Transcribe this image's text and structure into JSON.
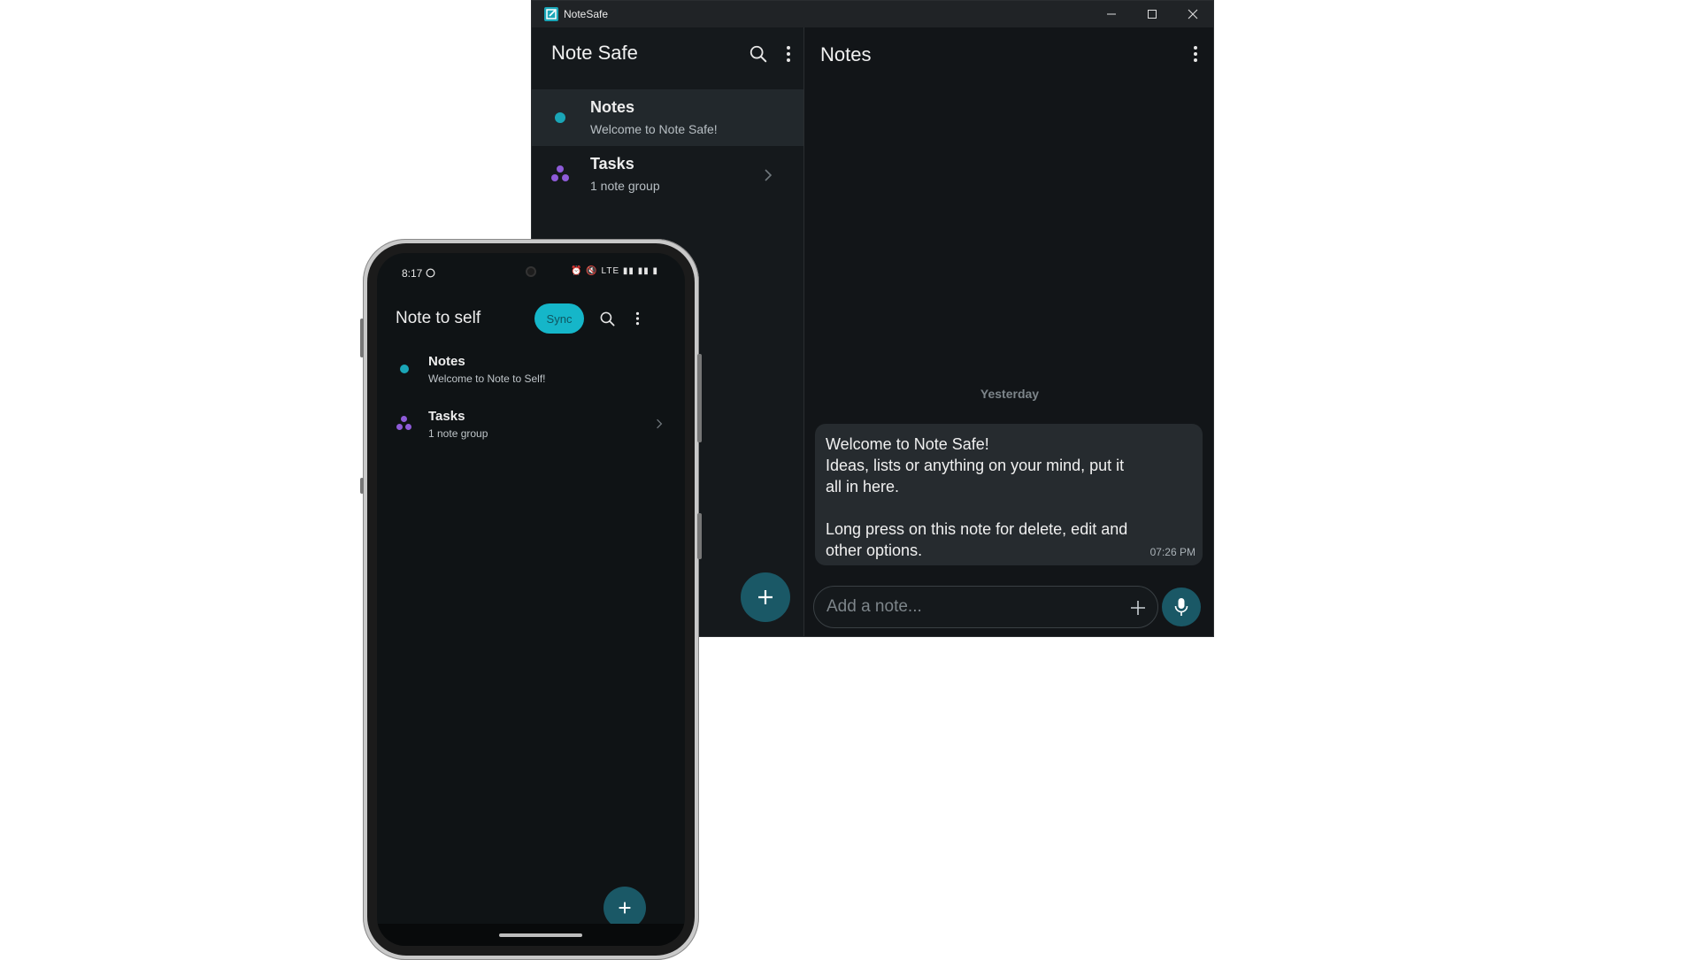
{
  "desktop": {
    "window_title": "NoteSafe",
    "sidebar": {
      "title": "Note Safe",
      "items": [
        {
          "title": "Notes",
          "subtitle": "Welcome to Note Safe!",
          "active": true
        },
        {
          "title": "Tasks",
          "subtitle": "1 note group",
          "active": false
        }
      ]
    },
    "main": {
      "title": "Notes",
      "day_separator": "Yesterday",
      "message": {
        "text": "Welcome to Note Safe!\nIdeas, lists or anything on your mind, put it all in here.\n\nLong press on this note for delete, edit and other options.",
        "time": "07:26 PM"
      },
      "input_placeholder": "Add a note..."
    }
  },
  "phone": {
    "status_time": "8:17",
    "status_icons": "⏰ 🔇 LTE ▮▮ ▮▮ ▮",
    "title": "Note to self",
    "sync_label": "Sync",
    "items": [
      {
        "title": "Notes",
        "subtitle": "Welcome to Note to Self!"
      },
      {
        "title": "Tasks",
        "subtitle": "1 note group"
      }
    ]
  },
  "colors": {
    "accent": "#1aa6b7",
    "fab": "#1a5866",
    "group_icon": "#8e5bd8",
    "background": "#121518"
  },
  "icons": [
    "app-icon",
    "search-icon",
    "more-vert-icon",
    "minimize-icon",
    "maximize-icon",
    "close-icon",
    "chevron-right-icon",
    "plus-icon",
    "mic-icon",
    "whatsapp-icon"
  ]
}
